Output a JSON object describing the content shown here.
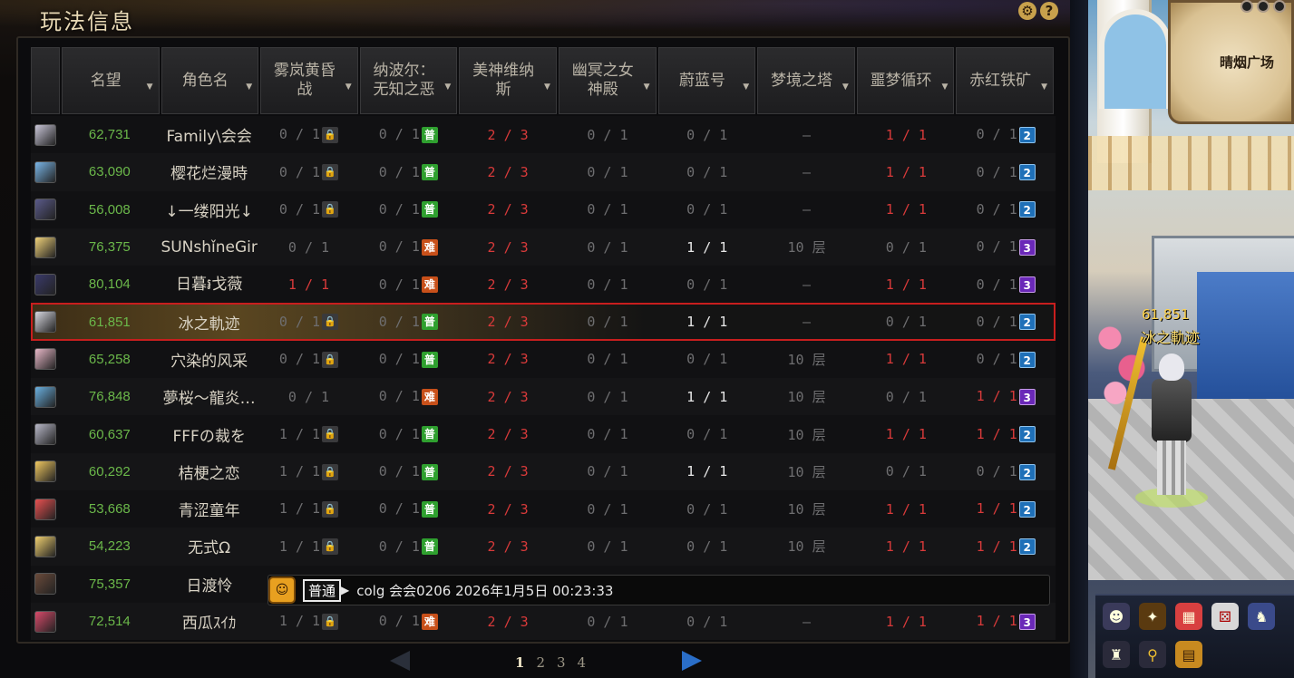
{
  "panel": {
    "title": "玩法信息",
    "settings_icon": "gear-icon",
    "help_icon": "?"
  },
  "headers": [
    "名望",
    "角色名",
    "雾岚黄昏战",
    "纳波尔：无知之恶",
    "美神维纳斯",
    "幽冥之女神殿",
    "蔚蓝号",
    "梦境之塔",
    "噩梦循环",
    "赤红铁矿"
  ],
  "rows": [
    {
      "fame": "62,731",
      "name": "Family\\会会",
      "v": [
        "0 / 1|lock",
        "0 / 1|普",
        "2 / 3",
        "0 / 1",
        "0 / 1",
        "–",
        "1 / 1",
        "0 / 1|2"
      ],
      "avatar": "#c9c6d8"
    },
    {
      "fame": "63,090",
      "name": "樱花烂漫時",
      "v": [
        "0 / 1|lock",
        "0 / 1|普",
        "2 / 3",
        "0 / 1",
        "0 / 1",
        "–",
        "1 / 1",
        "0 / 1|2"
      ],
      "avatar": "#7ab6e8"
    },
    {
      "fame": "56,008",
      "name": "↓一缕阳光↓",
      "v": [
        "0 / 1|lock",
        "0 / 1|普",
        "2 / 3",
        "0 / 1",
        "0 / 1",
        "–",
        "1 / 1",
        "0 / 1|2"
      ],
      "avatar": "#5a5a8a"
    },
    {
      "fame": "76,375",
      "name": "SUNshǐneGir",
      "v": [
        "0 / 1",
        "0 / 1|难",
        "2 / 3",
        "0 / 1",
        "1 / 1",
        "10 层",
        "0 / 1",
        "0 / 1|3"
      ],
      "avatar": "#f0d27a"
    },
    {
      "fame": "80,104",
      "name": "日暮៛戈薇",
      "v": [
        "1 / 1",
        "0 / 1|难",
        "2 / 3",
        "0 / 1",
        "0 / 1",
        "–",
        "1 / 1",
        "0 / 1|3"
      ],
      "avatar": "#3a3a6a"
    },
    {
      "fame": "61,851",
      "name": "冰之軌迹",
      "v": [
        "0 / 1|lock",
        "0 / 1|普",
        "2 / 3",
        "0 / 1",
        "1 / 1",
        "–",
        "0 / 1",
        "0 / 1|2"
      ],
      "avatar": "#d8d8e0",
      "me": true
    },
    {
      "fame": "65,258",
      "name": "穴染的风采",
      "v": [
        "0 / 1|lock",
        "0 / 1|普",
        "2 / 3",
        "0 / 1",
        "0 / 1",
        "10 层",
        "1 / 1",
        "0 / 1|2"
      ],
      "avatar": "#e8b8c8"
    },
    {
      "fame": "76,848",
      "name": "夢桜～龍炎…",
      "v": [
        "0 / 1",
        "0 / 1|难",
        "2 / 3",
        "0 / 1",
        "1 / 1",
        "10 层",
        "0 / 1",
        "1 / 1|3"
      ],
      "avatar": "#6ab0e0"
    },
    {
      "fame": "60,637",
      "name": "FFFの裁を",
      "v": [
        "1 / 1|lock",
        "0 / 1|普",
        "2 / 3",
        "0 / 1",
        "0 / 1",
        "10 层",
        "1 / 1",
        "1 / 1|2"
      ],
      "avatar": "#b8b8c8"
    },
    {
      "fame": "60,292",
      "name": "桔梗之恋",
      "v": [
        "1 / 1|lock",
        "0 / 1|普",
        "2 / 3",
        "0 / 1",
        "1 / 1",
        "10 层",
        "0 / 1",
        "0 / 1|2"
      ],
      "avatar": "#f0c860"
    },
    {
      "fame": "53,668",
      "name": "青涩童年",
      "v": [
        "1 / 1|lock",
        "0 / 1|普",
        "2 / 3",
        "0 / 1",
        "0 / 1",
        "10 层",
        "1 / 1",
        "1 / 1|2"
      ],
      "avatar": "#e85050"
    },
    {
      "fame": "54,223",
      "name": "无式Ω",
      "v": [
        "1 / 1|lock",
        "0 / 1|普",
        "2 / 3",
        "0 / 1",
        "0 / 1",
        "10 层",
        "1 / 1",
        "1 / 1|2"
      ],
      "avatar": "#f0d070"
    },
    {
      "fame": "75,357",
      "name": "日渡怜",
      "v": [],
      "avatar": "#6a4a3a"
    },
    {
      "fame": "72,514",
      "name": "西瓜ｽｲｶ",
      "v": [
        "1 / 1|lock",
        "0 / 1|难",
        "2 / 3",
        "0 / 1",
        "0 / 1",
        "–",
        "1 / 1",
        "1 / 1|3"
      ],
      "avatar": "#d84a6a"
    }
  ],
  "chat": {
    "channel": "普通",
    "message": "colg 会会0206 2026年1月5日 00:23:33"
  },
  "pager": {
    "pages": [
      "1",
      "2",
      "3",
      "4"
    ],
    "current": "1"
  },
  "game": {
    "map_label": "晴烟广场",
    "player_fame": "61,851",
    "player_name": "冰之軌迹"
  }
}
